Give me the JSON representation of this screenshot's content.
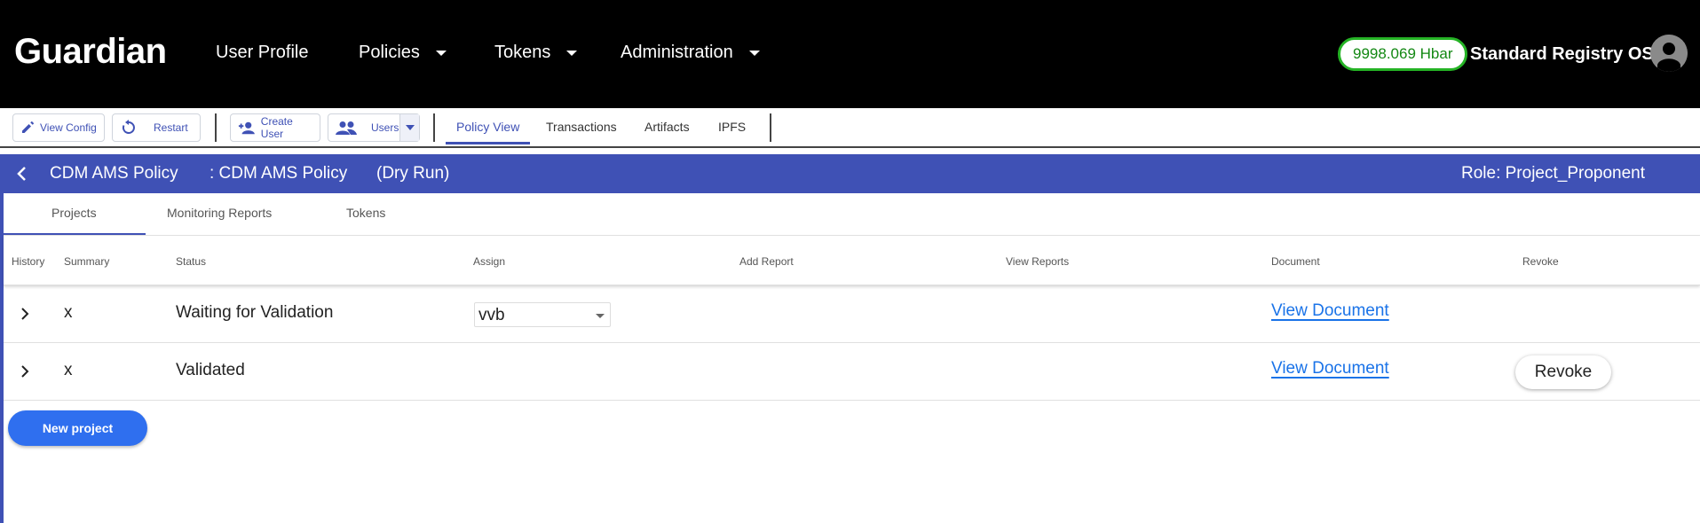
{
  "header": {
    "logo": "Guardian",
    "nav": [
      {
        "label": "User Profile",
        "dropdown": false
      },
      {
        "label": "Policies",
        "dropdown": true
      },
      {
        "label": "Tokens",
        "dropdown": true
      },
      {
        "label": "Administration",
        "dropdown": true
      }
    ],
    "balance": "9998.069 Hbar",
    "user_name": "Standard Registry OS",
    "avatar_icon": "account-circle-icon"
  },
  "toolbar": {
    "view_config": "View Config",
    "restart": "Restart",
    "create_user": "Create User",
    "users": "Users",
    "tabs": [
      "Policy View",
      "Transactions",
      "Artifacts",
      "IPFS"
    ],
    "active_tab": "Policy View"
  },
  "policy_bar": {
    "name": "CDM AMS Policy",
    "subtitle": ": CDM AMS Policy",
    "mode": "(Dry Run)",
    "role": "Role: Project_Proponent"
  },
  "inner_tabs": [
    "Projects",
    "Monitoring Reports",
    "Tokens"
  ],
  "table": {
    "headers": [
      "History",
      "Summary",
      "Status",
      "Assign",
      "Add Report",
      "View Reports",
      "Document",
      "Revoke"
    ],
    "rows": [
      {
        "summary": "x",
        "status": "Waiting for Validation",
        "assign": "vvb",
        "document": "View Document",
        "revoke": ""
      },
      {
        "summary": "x",
        "status": "Validated",
        "assign": "",
        "document": "View Document",
        "revoke": "Revoke"
      }
    ]
  },
  "new_project": "New project",
  "colors": {
    "header_bg": "#000000",
    "accent": "#3f51b5",
    "balance_border": "#25b325",
    "link": "#1a73e8",
    "primary_button": "#2f6fef"
  }
}
